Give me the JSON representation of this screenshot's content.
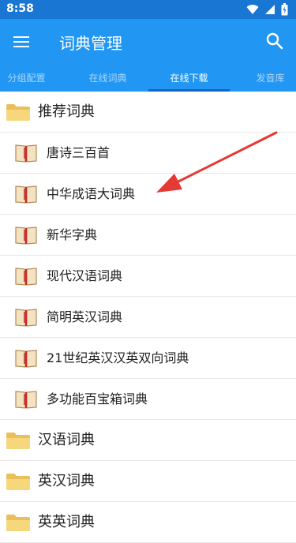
{
  "status_bar": {
    "time": "8:58"
  },
  "toolbar": {
    "title": "词典管理"
  },
  "tabs": [
    {
      "label": "分组配置"
    },
    {
      "label": "在线词典"
    },
    {
      "label": "在线下载",
      "active": true
    },
    {
      "label": "发音库"
    }
  ],
  "list": {
    "groups": [
      {
        "label": "推荐词典",
        "items": [
          {
            "label": "唐诗三百首"
          },
          {
            "label": "中华成语大词典"
          },
          {
            "label": "新华字典"
          },
          {
            "label": "现代汉语词典"
          },
          {
            "label": "简明英汉词典"
          },
          {
            "label": "21世纪英汉汉英双向词典"
          },
          {
            "label": "多功能百宝箱词典"
          }
        ]
      },
      {
        "label": "汉语词典"
      },
      {
        "label": "英汉词典"
      },
      {
        "label": "英英词典"
      }
    ]
  },
  "colors": {
    "toolbar": "#2196f3",
    "status_bar": "#1976d2",
    "tab_indicator": "#1565c0",
    "annotation_arrow": "#e53935"
  },
  "icons": {
    "group": "folder-icon",
    "item": "book-icon",
    "menu": "hamburger-menu-icon",
    "search": "search-icon"
  }
}
